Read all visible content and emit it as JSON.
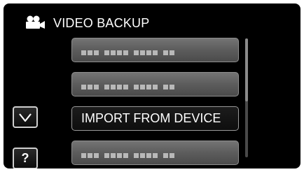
{
  "header": {
    "icon": "video-camera-icon",
    "title": "VIDEO BACKUP"
  },
  "menu": {
    "items": [
      {
        "label": "",
        "state": "obscured"
      },
      {
        "label": "",
        "state": "obscured"
      },
      {
        "label": "IMPORT FROM DEVICE",
        "state": "selected"
      },
      {
        "label": "",
        "state": "obscured"
      }
    ]
  },
  "side_buttons": {
    "down_icon": "chevron-down-icon",
    "help_label": "?"
  },
  "colors": {
    "screen_bg": "#000000",
    "button_gray": "#5c5c5c",
    "selected_bg": "#0e0e0e",
    "text": "#ffffff"
  }
}
